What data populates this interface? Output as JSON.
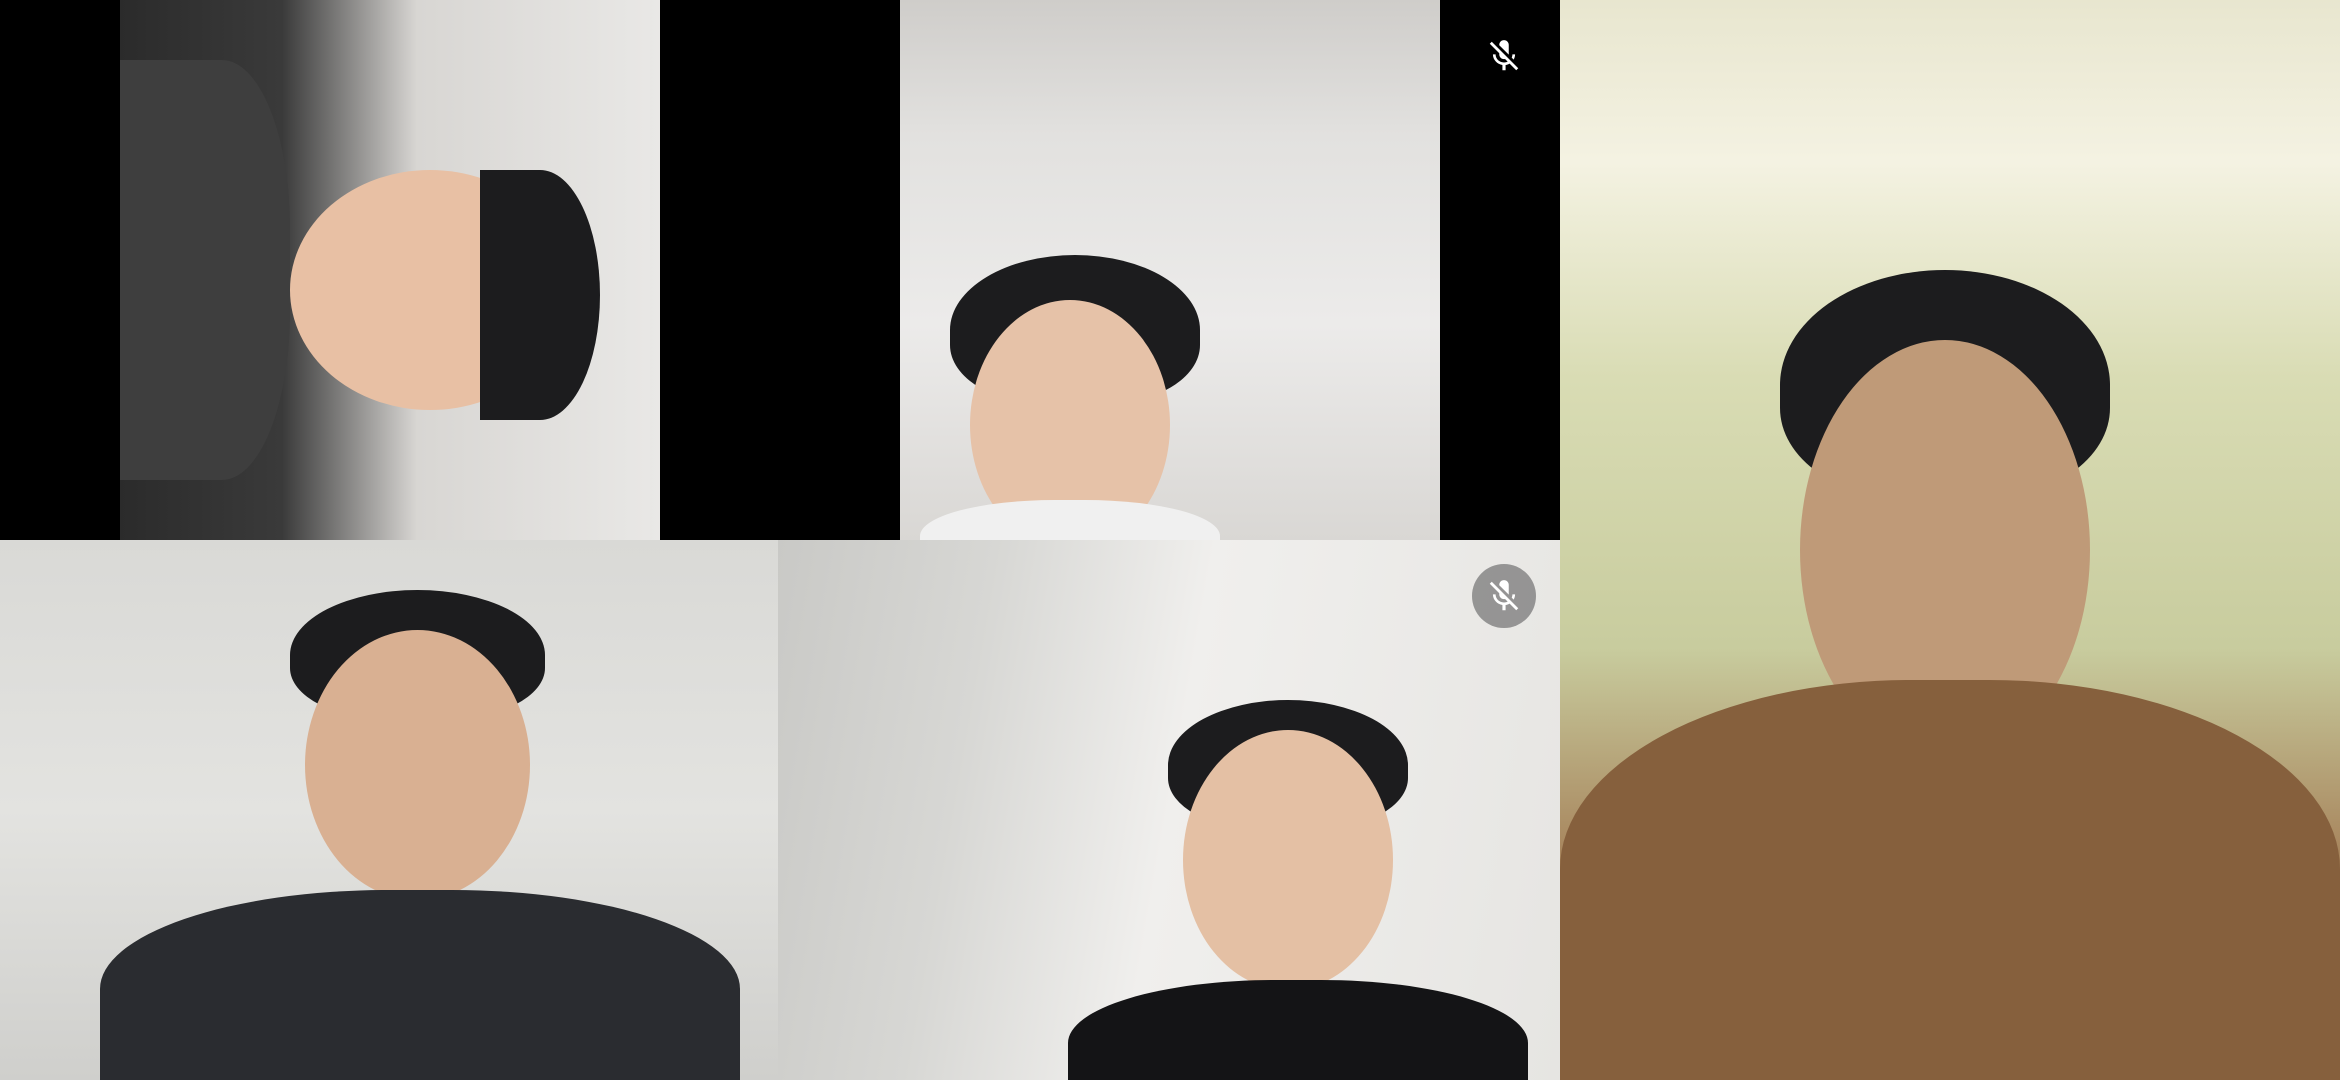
{
  "call": {
    "participants": [
      {
        "tile": 1,
        "muted": false,
        "orientation": "rotated"
      },
      {
        "tile": 2,
        "muted": true
      },
      {
        "tile": 3,
        "muted": false
      },
      {
        "tile": 4,
        "muted": true
      },
      {
        "tile": 5,
        "muted": false
      }
    ]
  },
  "icons": {
    "mute_icon": "mic-off-icon"
  },
  "colors": {
    "background": "#000000",
    "mute_badge": "#787878"
  }
}
